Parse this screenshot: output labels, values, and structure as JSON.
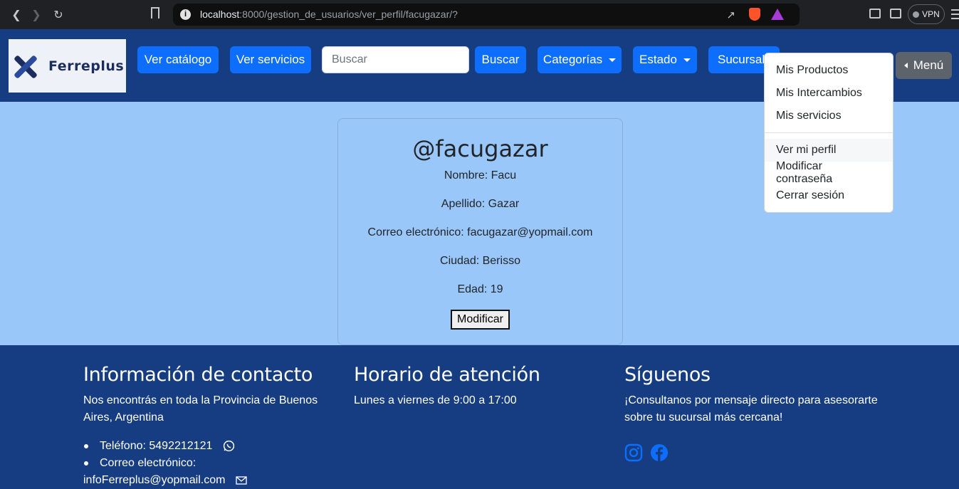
{
  "browser": {
    "url_host": "localhost",
    "url_rest": ":8000/gestion_de_usuarios/ver_perfil/facugazar/?",
    "vpn_label": "VPN"
  },
  "navbar": {
    "logo_text": "Ferreplus",
    "ver_catalogo": "Ver catálogo",
    "ver_servicios": "Ver servicios",
    "search_placeholder": "Buscar",
    "search_button": "Buscar",
    "categorias": "Categorías",
    "estado": "Estado",
    "sucursal": "Sucursal",
    "menu": "Menú"
  },
  "dropdown": {
    "items_top": [
      "Mis Productos",
      "Mis Intercambios",
      "Mis servicios"
    ],
    "items_bottom": [
      "Ver mi perfil",
      "Modificar contraseña",
      "Cerrar sesión"
    ]
  },
  "profile": {
    "handle": "@facugazar",
    "nombre": "Nombre: Facu",
    "apellido": "Apellido: Gazar",
    "correo": "Correo electrónico: facugazar@yopmail.com",
    "ciudad": "Ciudad: Berisso",
    "edad": "Edad: 19",
    "modify_button": "Modificar"
  },
  "footer": {
    "contact": {
      "title": "Información de contacto",
      "text": "Nos encontrás en toda la Provincia de Buenos Aires, Argentina",
      "phone": "Teléfono: 5492212121",
      "email_label": "Correo electrónico:",
      "email": "infoFerreplus@yopmail.com"
    },
    "hours": {
      "title": "Horario de atención",
      "text": "Lunes a viernes de 9:00 a 17:00"
    },
    "follow": {
      "title": "Síguenos",
      "text": "¡Consultanos por mensaje directo para asesorarte sobre tu sucursal más cercana!"
    }
  },
  "colors": {
    "navbar_bg": "#163d82",
    "page_bg": "#9ac7fa",
    "primary": "#0d6efd",
    "secondary": "#5c636a"
  }
}
